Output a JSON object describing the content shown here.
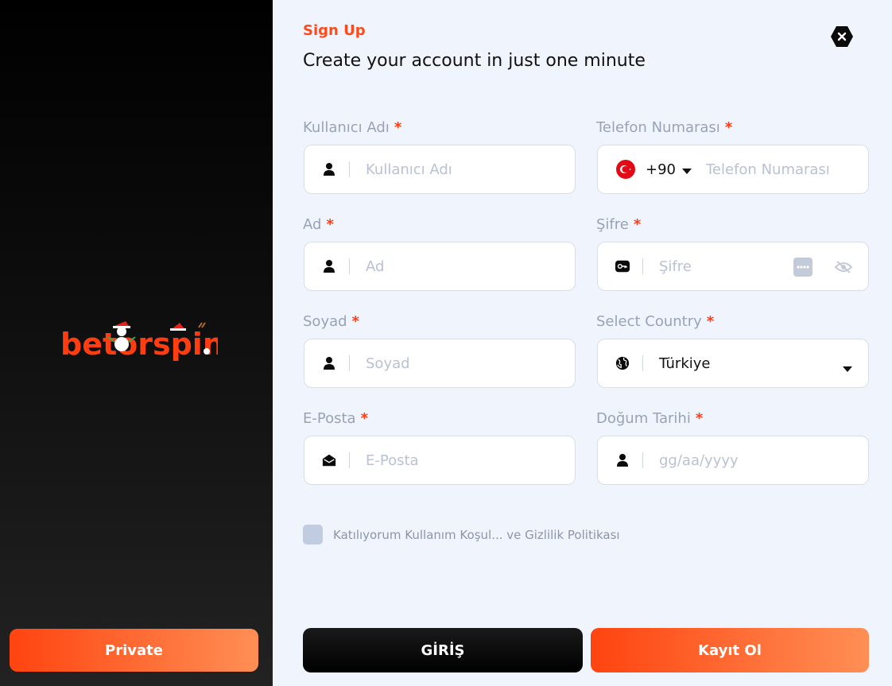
{
  "brand": {
    "logo_text": "betorspin",
    "accent": "#ff4a1c"
  },
  "sidebar": {
    "private_label": "Private"
  },
  "header": {
    "eyebrow": "Sign Up",
    "title": "Create your account in just one minute",
    "close_icon": "close-icon"
  },
  "form": {
    "username": {
      "label": "Kullanıcı Adı",
      "placeholder": "Kullanıcı Adı",
      "icon": "user-icon"
    },
    "phone": {
      "label": "Telefon Numarası",
      "country_code": "+90",
      "placeholder": "Telefon Numarası",
      "icon": "turkey-flag-icon"
    },
    "first_name": {
      "label": "Ad",
      "placeholder": "Ad",
      "icon": "user-icon"
    },
    "password": {
      "label": "Şifre",
      "placeholder": "Şifre",
      "icon": "key-icon"
    },
    "last_name": {
      "label": "Soyad",
      "placeholder": "Soyad",
      "icon": "user-icon"
    },
    "country": {
      "label": "Select Country",
      "value": "Türkiye",
      "icon": "globe-icon"
    },
    "email": {
      "label": "E-Posta",
      "placeholder": "E-Posta",
      "icon": "envelope-icon"
    },
    "birthdate": {
      "label": "Doğum Tarihi",
      "placeholder": "gg/aa/yyyy",
      "icon": "user-icon"
    },
    "required_mark": "*"
  },
  "consent": {
    "text": "Katılıyorum Kullanım Koşul... ve Gizlilik Politikası"
  },
  "actions": {
    "login_label": "GİRİŞ",
    "register_label": "Kayıt Ol"
  }
}
